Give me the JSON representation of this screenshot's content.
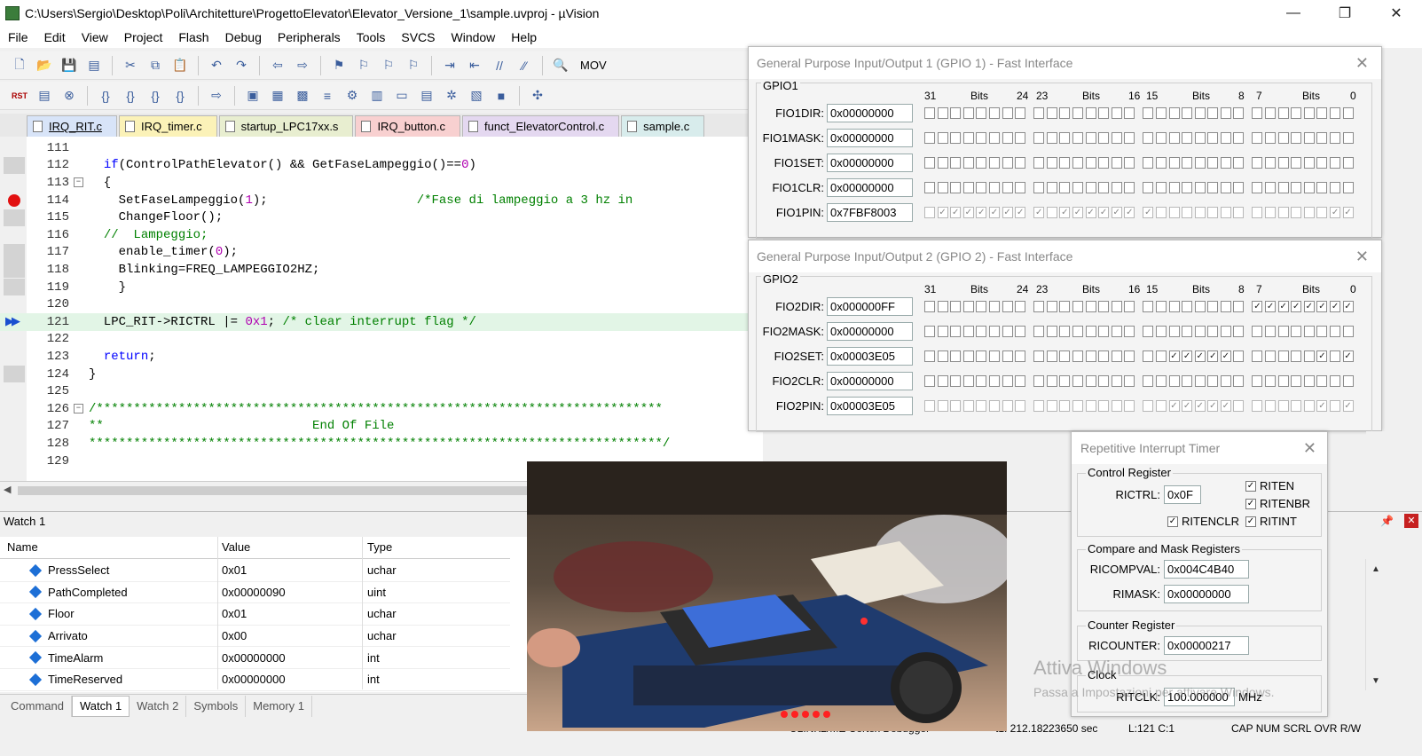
{
  "window": {
    "title": "C:\\Users\\Sergio\\Desktop\\Poli\\Architetture\\ProgettoElevator\\Elevator_Versione_1\\sample.uvproj - µVision",
    "minimize": "—",
    "maximize": "❐",
    "close": "✕"
  },
  "menu": [
    "File",
    "Edit",
    "View",
    "Project",
    "Flash",
    "Debug",
    "Peripherals",
    "Tools",
    "SVCS",
    "Window",
    "Help"
  ],
  "toolbar": {
    "mov_label": "MOV"
  },
  "tabs": [
    {
      "label": "IRQ_RIT.c",
      "active": true
    },
    {
      "label": "IRQ_timer.c"
    },
    {
      "label": "startup_LPC17xx.s"
    },
    {
      "label": "IRQ_button.c"
    },
    {
      "label": "funct_ElevatorControl.c"
    },
    {
      "label": "sample.c"
    }
  ],
  "code": [
    {
      "n": "111",
      "t": ""
    },
    {
      "n": "112",
      "t": "  if(ControlPathElevator() && GetFaseLampeggio()==0)"
    },
    {
      "n": "113",
      "t": "  {"
    },
    {
      "n": "114",
      "t": "    SetFaseLampeggio(1);                    /*Fase di lampeggio a 3 hz in"
    },
    {
      "n": "115",
      "t": "    ChangeFloor();"
    },
    {
      "n": "116",
      "t": "  //  Lampeggio;"
    },
    {
      "n": "117",
      "t": "    enable_timer(0);"
    },
    {
      "n": "118",
      "t": "    Blinking=FREQ_LAMPEGGIO2HZ;"
    },
    {
      "n": "119",
      "t": "    }"
    },
    {
      "n": "120",
      "t": ""
    },
    {
      "n": "121",
      "t": "  LPC_RIT->RICTRL |= 0x1; /* clear interrupt flag */"
    },
    {
      "n": "122",
      "t": ""
    },
    {
      "n": "123",
      "t": "  return;"
    },
    {
      "n": "124",
      "t": "}"
    },
    {
      "n": "125",
      "t": ""
    },
    {
      "n": "126",
      "t": "/****************************************************************************"
    },
    {
      "n": "127",
      "t": "**                            End Of File"
    },
    {
      "n": "128",
      "t": "*****************************************************************************/"
    },
    {
      "n": "129",
      "t": ""
    }
  ],
  "watch": {
    "title": "Watch 1",
    "headers": {
      "name": "Name",
      "value": "Value",
      "type": "Type"
    },
    "rows": [
      {
        "name": "PressSelect",
        "value": "0x01",
        "type": "uchar"
      },
      {
        "name": "PathCompleted",
        "value": "0x00000090",
        "type": "uint"
      },
      {
        "name": "Floor",
        "value": "0x01",
        "type": "uchar"
      },
      {
        "name": "Arrivato",
        "value": "0x00",
        "type": "uchar"
      },
      {
        "name": "TimeAlarm",
        "value": "0x00000000",
        "type": "int"
      },
      {
        "name": "TimeReserved",
        "value": "0x00000000",
        "type": "int"
      }
    ]
  },
  "bottom_tabs": [
    "Command",
    "Watch 1",
    "Watch 2",
    "Symbols",
    "Memory 1"
  ],
  "status": {
    "debugger": "ULINK2/ME Cortex Debugger",
    "time": "t1: 212.18223650 sec",
    "pos": "L:121 C:1",
    "flags": "CAP  NUM  SCRL  OVR  R/W"
  },
  "gpio1": {
    "title": "General Purpose Input/Output 1 (GPIO 1) - Fast Interface",
    "group": "GPIO1",
    "hdr": {
      "b31": "31",
      "bits": "Bits",
      "b24": "24",
      "b23": "23",
      "b16": "16",
      "b15": "15",
      "b8": "8",
      "b7": "7",
      "b0": "0"
    },
    "regs": [
      {
        "name": "FIO1DIR:",
        "value": "0x00000000"
      },
      {
        "name": "FIO1MASK:",
        "value": "0x00000000"
      },
      {
        "name": "FIO1SET:",
        "value": "0x00000000"
      },
      {
        "name": "FIO1CLR:",
        "value": "0x00000000"
      },
      {
        "name": "FIO1PIN:",
        "value": "0x7FBF8003"
      }
    ]
  },
  "gpio2": {
    "title": "General Purpose Input/Output 2 (GPIO 2) - Fast Interface",
    "group": "GPIO2",
    "hdr": {
      "b31": "31",
      "bits": "Bits",
      "b24": "24",
      "b23": "23",
      "b16": "16",
      "b15": "15",
      "b8": "8",
      "b7": "7",
      "b0": "0"
    },
    "regs": [
      {
        "name": "FIO2DIR:",
        "value": "0x000000FF"
      },
      {
        "name": "FIO2MASK:",
        "value": "0x00000000"
      },
      {
        "name": "FIO2SET:",
        "value": "0x00003E05"
      },
      {
        "name": "FIO2CLR:",
        "value": "0x00000000"
      },
      {
        "name": "FIO2PIN:",
        "value": "0x00003E05"
      }
    ]
  },
  "rit": {
    "title": "Repetitive Interrupt Timer",
    "control_group": "Control Register",
    "rictrl_label": "RICTRL:",
    "rictrl_value": "0x0F",
    "riten": "RITEN",
    "ritenbr": "RITENBR",
    "ritenclr": "RITENCLR",
    "ritint": "RITINT",
    "compare_group": "Compare and Mask Registers",
    "ricompval_label": "RICOMPVAL:",
    "ricompval_value": "0x004C4B40",
    "rimask_label": "RIMASK:",
    "rimask_value": "0x00000000",
    "counter_group": "Counter Register",
    "ricounter_label": "RICOUNTER:",
    "ricounter_value": "0x00000217",
    "clock_group": "Clock",
    "ritclk_label": "RITCLK:",
    "ritclk_value": "100.000000",
    "ritclk_unit": "MHz"
  },
  "watermark": {
    "line1": "Attiva Windows",
    "line2": "Passa a Impostazioni per attivare Windows."
  }
}
